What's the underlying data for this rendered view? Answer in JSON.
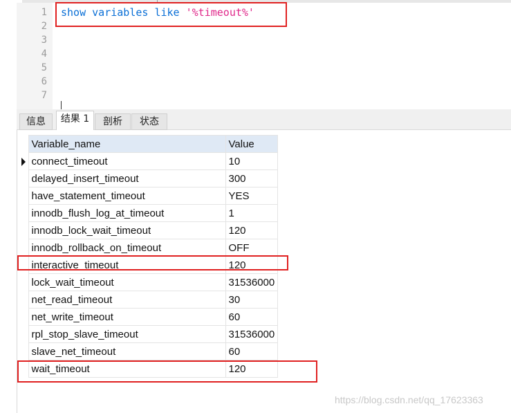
{
  "editor": {
    "line_numbers": [
      "1",
      "2",
      "3",
      "4",
      "5",
      "6",
      "7"
    ],
    "code": {
      "keyword": "show variables like",
      "string": "'%timeout%'"
    }
  },
  "tabs": [
    {
      "label": "信息",
      "active": false
    },
    {
      "label": "结果 1",
      "active": true
    },
    {
      "label": "剖析",
      "active": false
    },
    {
      "label": "状态",
      "active": false
    }
  ],
  "results": {
    "columns": [
      "Variable_name",
      "Value"
    ],
    "rows": [
      {
        "name": "connect_timeout",
        "value": "10"
      },
      {
        "name": "delayed_insert_timeout",
        "value": "300"
      },
      {
        "name": "have_statement_timeout",
        "value": "YES"
      },
      {
        "name": "innodb_flush_log_at_timeout",
        "value": "1"
      },
      {
        "name": "innodb_lock_wait_timeout",
        "value": "120"
      },
      {
        "name": "innodb_rollback_on_timeout",
        "value": "OFF"
      },
      {
        "name": "interactive_timeout",
        "value": "120"
      },
      {
        "name": "lock_wait_timeout",
        "value": "31536000"
      },
      {
        "name": "net_read_timeout",
        "value": "30"
      },
      {
        "name": "net_write_timeout",
        "value": "60"
      },
      {
        "name": "rpl_stop_slave_timeout",
        "value": "31536000"
      },
      {
        "name": "slave_net_timeout",
        "value": "60"
      },
      {
        "name": "wait_timeout",
        "value": "120"
      }
    ]
  },
  "watermark": "https://blog.csdn.net/qq_17623363",
  "colors": {
    "highlight_box": "#e02020",
    "keyword": "#0a6fd6",
    "string": "#e0288a",
    "header_bg": "#dfe9f5"
  }
}
